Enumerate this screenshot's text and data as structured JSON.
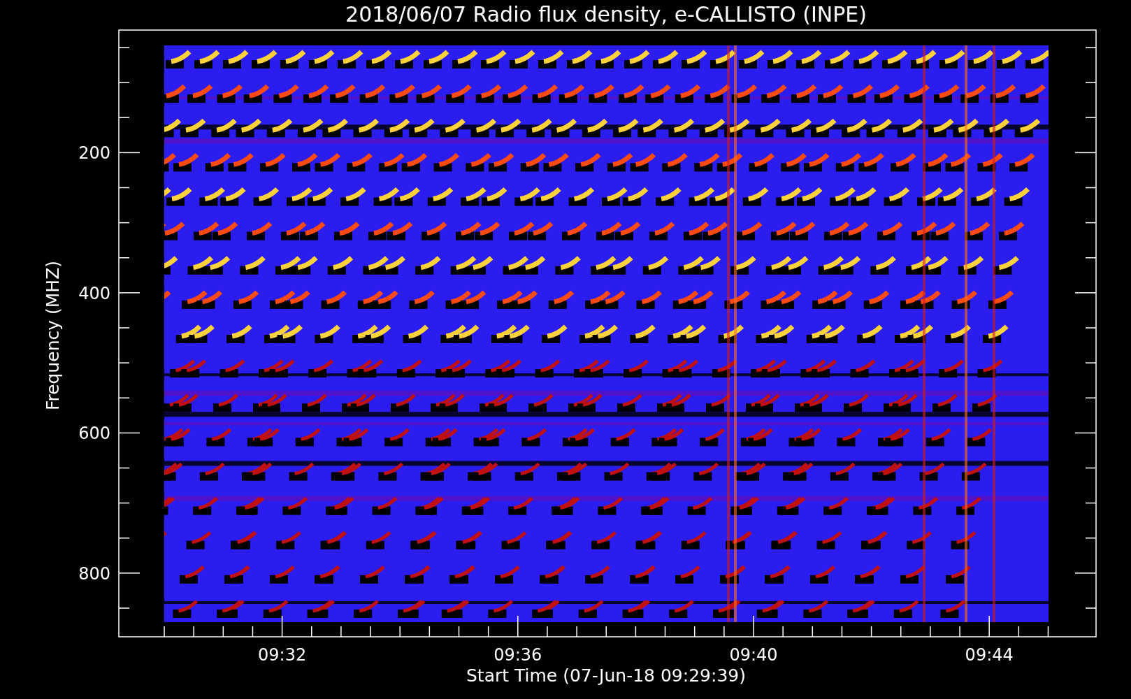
{
  "title": "2018/06/07  Radio flux density, e-CALLISTO (INPE)",
  "ylabel": "Frequency (MHZ)",
  "xlabel": "Start Time (07-Jun-18 09:29:39)",
  "yticks": [
    "200",
    "400",
    "600",
    "800"
  ],
  "xticks": [
    "09:32",
    "09:36",
    "09:40",
    "09:44"
  ]
}
